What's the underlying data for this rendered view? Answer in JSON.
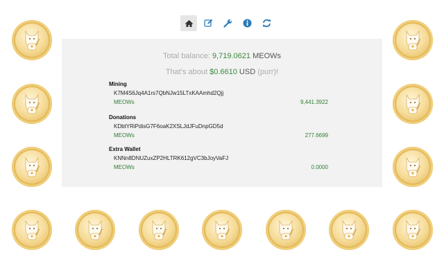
{
  "toolbar": {
    "items": [
      {
        "name": "home",
        "icon": "home-icon",
        "active": true
      },
      {
        "name": "edit",
        "icon": "edit-icon"
      },
      {
        "name": "settings",
        "icon": "wrench-icon"
      },
      {
        "name": "info",
        "icon": "info-icon"
      },
      {
        "name": "refresh",
        "icon": "refresh-icon"
      }
    ]
  },
  "summary": {
    "total_label": "Total balance:",
    "total_value": "9,719.0621",
    "total_unit": "MEOWs",
    "usd_prefix": "That's about",
    "usd_value": "$0.6610",
    "usd_unit": "USD",
    "usd_suffix": "(purr)!"
  },
  "wallets": [
    {
      "name": "Mining",
      "address": "K7M4S6Jq4A1rs7QbNJw15LTxKAAmhd2Qjj",
      "unit": "MEOWs",
      "balance": "9,441.3922"
    },
    {
      "name": "Donations",
      "address": "KDbtYRiPdisG7F6oaK2XSLJdJFuDnpGD5d",
      "unit": "MEOWs",
      "balance": "277.6699"
    },
    {
      "name": "Extra Wallet",
      "address": "KNNn8DNUZuxZP2HLTRK612gVC3bJoyVaFJ",
      "unit": "MEOWs",
      "balance": "0.0000"
    }
  ],
  "colors": {
    "accent": "#3a8a3a",
    "icon": "#2a7ab8"
  }
}
